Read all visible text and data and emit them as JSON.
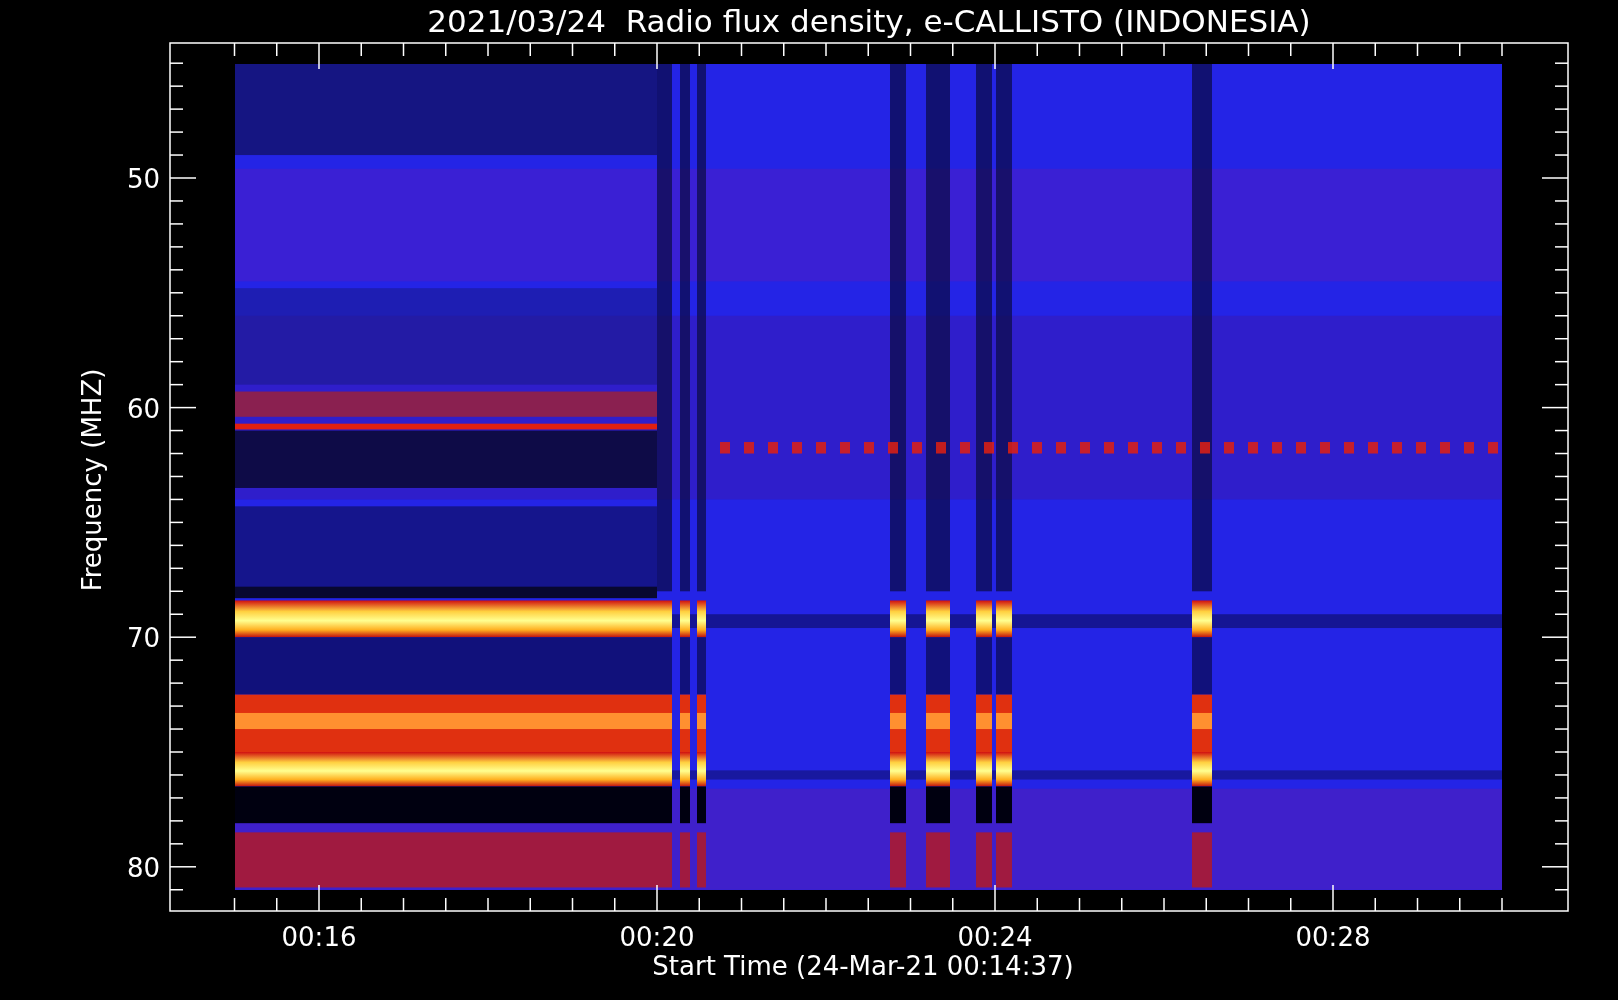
{
  "title": "2021/03/24  Radio flux density, e-CALLISTO (INDONESIA)",
  "chart": {
    "ylabel": "Frequency (MHZ)",
    "xlabel": "Start Time (24-Mar-21 00:14:37)",
    "yticks": [
      "50",
      "60",
      "70",
      "80"
    ],
    "xticks": [
      "00:16",
      "00:20",
      "00:24",
      "00:28"
    ]
  }
}
